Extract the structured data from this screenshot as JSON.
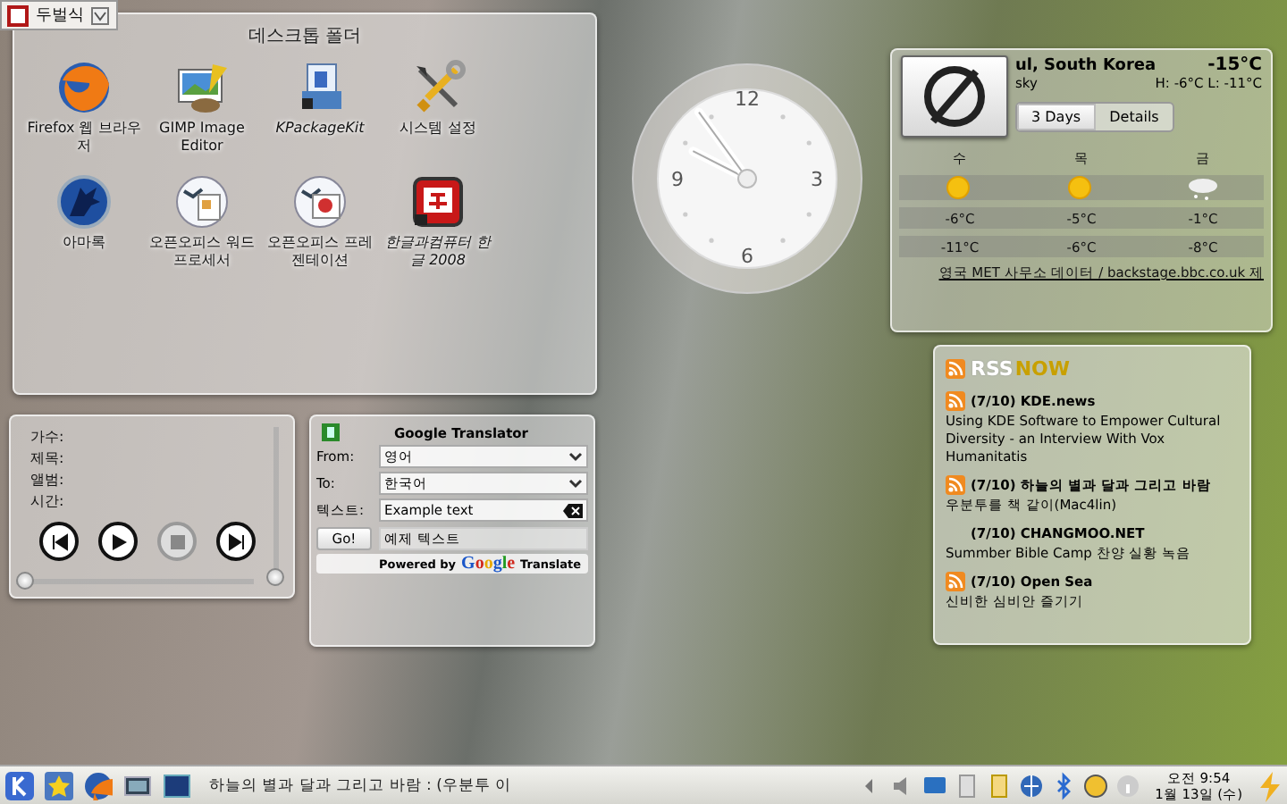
{
  "keyboard_layout": {
    "label": "두벌식"
  },
  "folder_view": {
    "title": "데스크톱 폴더",
    "items": [
      {
        "label": "Firefox 웹 브라우저",
        "kind": "globe",
        "italic": false
      },
      {
        "label": "GIMP Image Editor",
        "kind": "painting",
        "italic": false
      },
      {
        "label": "KPackageKit",
        "kind": "package",
        "italic": true
      },
      {
        "label": "시스템 설정",
        "kind": "tools",
        "italic": false
      },
      {
        "label": "아마록",
        "kind": "wolf",
        "italic": false
      },
      {
        "label": "오픈오피스 워드 프로세서",
        "kind": "document",
        "italic": false
      },
      {
        "label": "오픈오피스 프레젠테이션",
        "kind": "presentation",
        "italic": false
      },
      {
        "label": "한글과컴퓨터 한글 2008",
        "kind": "hangul",
        "italic": true
      }
    ]
  },
  "clock": {
    "numerals": [
      "12",
      "3",
      "6",
      "9"
    ]
  },
  "weather": {
    "location": "ul, South Korea",
    "condition": "sky",
    "temperature": "-15°C",
    "high_low": "H: -6°C L: -11°C",
    "tabs": [
      {
        "label": "3 Days",
        "selected": true
      },
      {
        "label": "Details",
        "selected": false
      }
    ],
    "days": [
      {
        "day": "수",
        "kind": "sun",
        "high": "-6°C",
        "low": "-11°C"
      },
      {
        "day": "목",
        "kind": "sun",
        "high": "-5°C",
        "low": "-6°C"
      },
      {
        "day": "금",
        "kind": "snow",
        "high": "-1°C",
        "low": "-8°C"
      }
    ],
    "source": "영국 MET 사무소 데이터 / backstage.bbc.co.uk 제"
  },
  "media_player": {
    "fields": [
      "가수:",
      "제목:",
      "앨범:",
      "시간:"
    ],
    "buttons": [
      {
        "kind": "previous",
        "disabled": false
      },
      {
        "kind": "play",
        "disabled": false
      },
      {
        "kind": "stop",
        "disabled": true
      },
      {
        "kind": "next",
        "disabled": false
      }
    ],
    "position": {
      "level": 0
    },
    "volume": {
      "level": 0
    }
  },
  "translator": {
    "title": "Google Translator",
    "from_label": "From:",
    "from": "영어",
    "to_label": "To:",
    "to": "한국어",
    "text_label": "텍스트:",
    "text": "Example text",
    "go": "Go!",
    "result": "예제 텍스트",
    "powered_by": "Powered by",
    "brand": "Google",
    "brand_suffix": "Translate"
  },
  "news": {
    "logo_left": "RSS",
    "logo_right": "NOW",
    "items": [
      {
        "source": "(7/10) KDE.news",
        "text": "Using KDE Software to Empower Cultural Diversity - an Interview With Vox Humanitatis",
        "icon": true
      },
      {
        "source": "(7/10) 하늘의 별과 달과 그리고 바람",
        "text": "우분투를 책 같이(Mac4lin)",
        "icon": true
      },
      {
        "source": "(7/10) CHANGMOO.NET",
        "text": "Summber Bible Camp 찬양 실황 녹음",
        "icon": false
      },
      {
        "source": "(7/10) Open Sea",
        "text": "신비한 심비안 즐기기",
        "icon": true
      }
    ]
  },
  "taskbar": {
    "task": "하늘의 별과 달과 그리고 바람 : (우분투 이",
    "time": "오전 9:54",
    "date": "1월 13일 (수)"
  }
}
